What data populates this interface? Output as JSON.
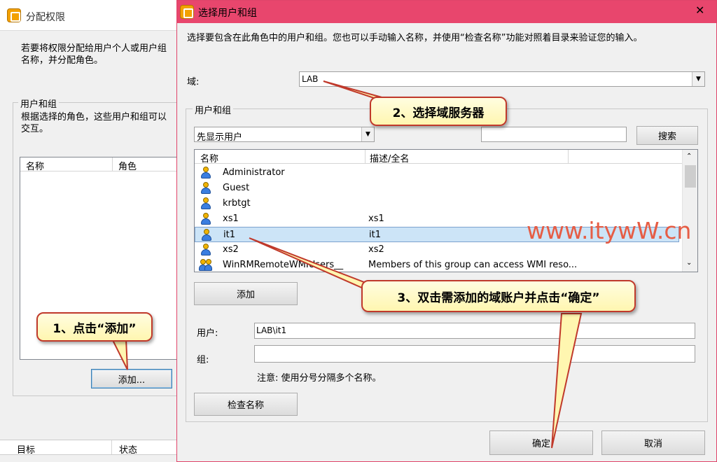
{
  "background_window": {
    "title": "分配权限",
    "description_line1": "若要将权限分配给用户个人或用户组",
    "description_line2": "名称，并分配角色。",
    "group_label": "用户和组",
    "group_desc_line1": "根据选择的角色，这些用户和组可以",
    "group_desc_line2": "交互。",
    "columns": [
      "名称",
      "角色"
    ],
    "add_button": "添加...",
    "bottom_columns": [
      "目标",
      "状态"
    ]
  },
  "dialog": {
    "title": "选择用户和组",
    "close_glyph": "✕",
    "instruction": "选择要包含在此角色中的用户和组。您也可以手动输入名称，并使用“检查名称”功能对照着目录来验证您的输入。",
    "domain_label": "域:",
    "domain_value": "LAB",
    "group_label": "用户和组",
    "filter_value": "先显示用户",
    "search_value": "",
    "search_button": "搜索",
    "columns": [
      "名称",
      "描述/全名"
    ],
    "rows": [
      {
        "name": "Administrator",
        "desc": "",
        "icon": "user-icon"
      },
      {
        "name": "Guest",
        "desc": "",
        "icon": "user-icon"
      },
      {
        "name": "krbtgt",
        "desc": "",
        "icon": "user-icon"
      },
      {
        "name": "xs1",
        "desc": "xs1",
        "icon": "user-icon"
      },
      {
        "name": "it1",
        "desc": "it1",
        "icon": "user-icon",
        "selected": true
      },
      {
        "name": "xs2",
        "desc": "xs2",
        "icon": "user-icon"
      },
      {
        "name": "WinRMRemoteWMIUsers__",
        "desc": "Members of this group can access WMI reso...",
        "icon": "group-icon"
      }
    ],
    "add_button": "添加",
    "user_label": "用户:",
    "user_value": "LAB\\it1",
    "group_field_label": "组:",
    "group_value": "",
    "note": "注意: 使用分号分隔多个名称。",
    "check_names_button": "检查名称",
    "ok_button": "确定",
    "cancel_button": "取消"
  },
  "annotations": {
    "callout1": "1、点击“添加”",
    "callout2": "2、选择域服务器",
    "callout3": "3、双击需添加的域账户并点击“确定”",
    "watermark": "www.itywW.cn"
  },
  "colors": {
    "dialog_titlebar": "#e8466d",
    "callout_border": "#c0392b",
    "callout_fill": "#fff6b0",
    "selection": "#cce4f7",
    "watermark": "#e65d45"
  }
}
